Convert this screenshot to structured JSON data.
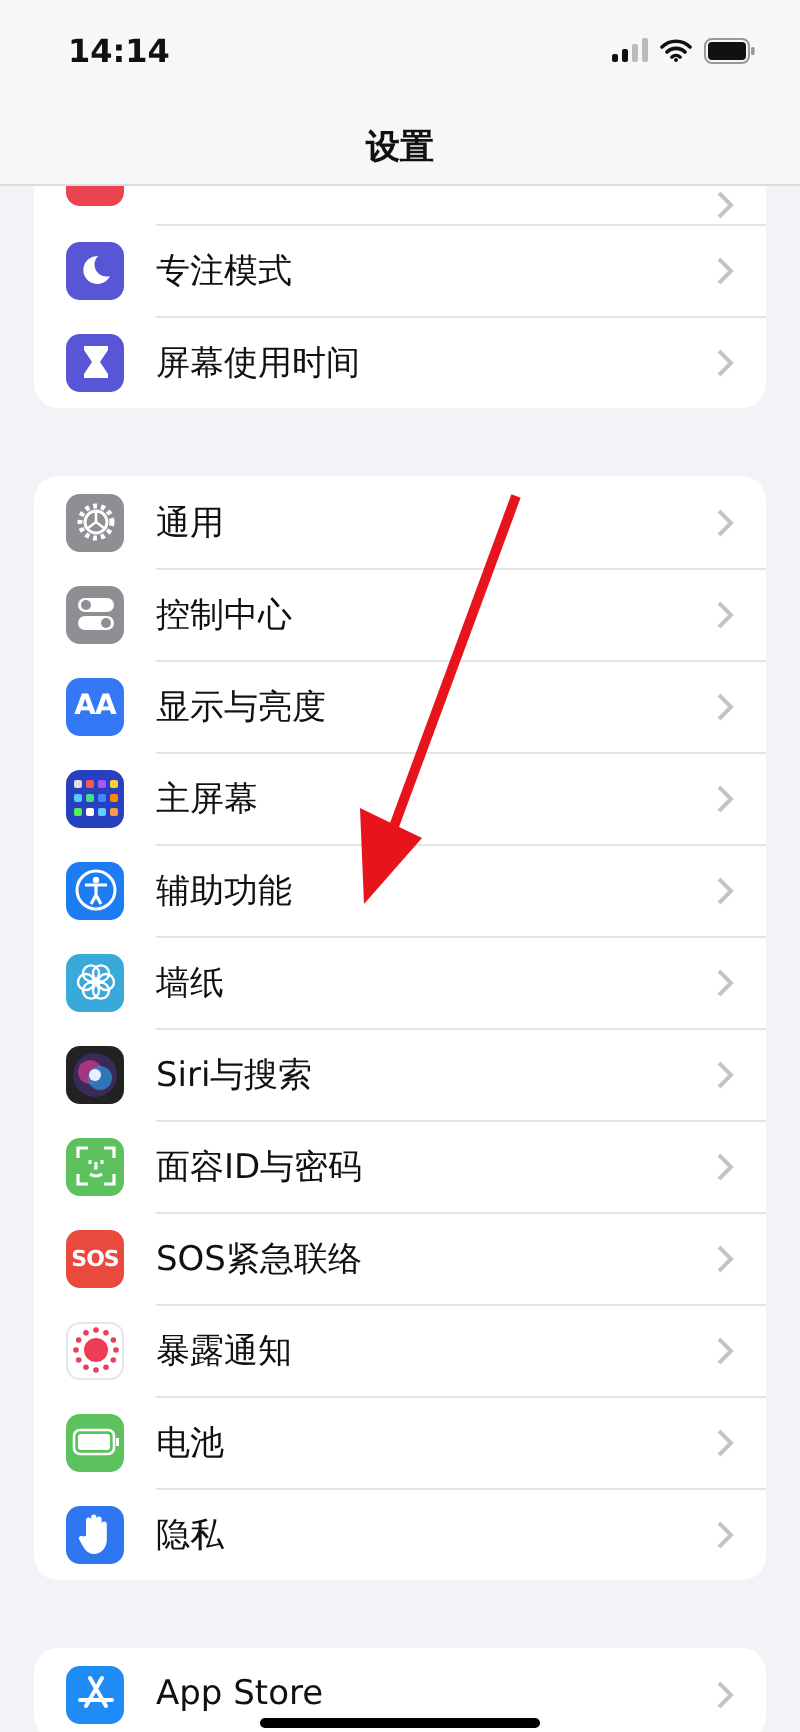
{
  "status_bar": {
    "time": "14:14"
  },
  "nav": {
    "title": "设置"
  },
  "groups": [
    {
      "rows": [
        {
          "kind": "sound",
          "label": ""
        },
        {
          "kind": "focus",
          "label": "专注模式"
        },
        {
          "kind": "screentime",
          "label": "屏幕使用时间"
        }
      ]
    },
    {
      "rows": [
        {
          "kind": "general",
          "label": "通用"
        },
        {
          "kind": "control",
          "label": "控制中心"
        },
        {
          "kind": "display",
          "label": "显示与亮度",
          "icon_text": "AA"
        },
        {
          "kind": "home",
          "label": "主屏幕"
        },
        {
          "kind": "accessibility",
          "label": "辅助功能"
        },
        {
          "kind": "wallpaper",
          "label": "墙纸"
        },
        {
          "kind": "siri",
          "label": "Siri与搜索"
        },
        {
          "kind": "faceid",
          "label": "面容ID与密码"
        },
        {
          "kind": "sos",
          "label": "SOS紧急联络",
          "icon_text": "SOS"
        },
        {
          "kind": "exposure",
          "label": "暴露通知"
        },
        {
          "kind": "battery",
          "label": "电池"
        },
        {
          "kind": "privacy",
          "label": "隐私"
        }
      ]
    },
    {
      "rows": [
        {
          "kind": "appstore",
          "label": "App Store"
        }
      ]
    }
  ]
}
